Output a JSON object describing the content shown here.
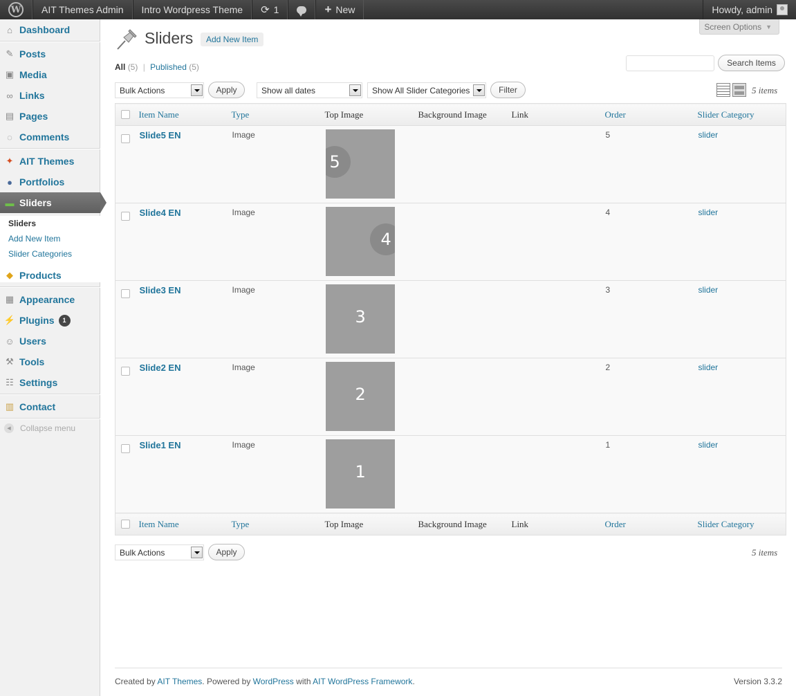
{
  "adminbar": {
    "site_admin": "AIT Themes Admin",
    "theme": "Intro Wordpress Theme",
    "updates_count": "1",
    "new_label": "New",
    "howdy": "Howdy, admin"
  },
  "sidebar": {
    "dashboard": "Dashboard",
    "posts": "Posts",
    "media": "Media",
    "links": "Links",
    "pages": "Pages",
    "comments": "Comments",
    "ait_themes": "AIT Themes",
    "portfolios": "Portfolios",
    "sliders": "Sliders",
    "submenu": {
      "sliders": "Sliders",
      "add_new": "Add New Item",
      "categories": "Slider Categories"
    },
    "products": "Products",
    "appearance": "Appearance",
    "plugins": "Plugins",
    "plugins_badge": "1",
    "users": "Users",
    "tools": "Tools",
    "settings": "Settings",
    "contact": "Contact",
    "collapse": "Collapse menu"
  },
  "main": {
    "screen_options": "Screen Options",
    "title": "Sliders",
    "add_new": "Add New Item",
    "views": {
      "all": "All",
      "all_count": "(5)",
      "sep": "|",
      "published": "Published",
      "published_count": "(5)"
    },
    "search_button": "Search Items",
    "search_value": "",
    "bulk_actions": "Bulk Actions",
    "apply": "Apply",
    "dates_filter": "Show all dates",
    "category_filter": "Show All Slider Categories",
    "filter_button": "Filter",
    "items_count": "5 items"
  },
  "table": {
    "columns": {
      "name": "Item Name",
      "type": "Type",
      "top_image": "Top Image",
      "background_image": "Background Image",
      "link": "Link",
      "order": "Order",
      "category": "Slider Category"
    },
    "rows": [
      {
        "name": "Slide5 EN",
        "type": "Image",
        "image_label": "5",
        "order": "5",
        "category": "slider"
      },
      {
        "name": "Slide4 EN",
        "type": "Image",
        "image_label": "4",
        "order": "4",
        "category": "slider"
      },
      {
        "name": "Slide3 EN",
        "type": "Image",
        "image_label": "3",
        "order": "3",
        "category": "slider"
      },
      {
        "name": "Slide2 EN",
        "type": "Image",
        "image_label": "2",
        "order": "2",
        "category": "slider"
      },
      {
        "name": "Slide1 EN",
        "type": "Image",
        "image_label": "1",
        "order": "1",
        "category": "slider"
      }
    ]
  },
  "footer": {
    "created_by": "Created by ",
    "ait_themes": "AIT Themes",
    "powered_by": ". Powered by ",
    "wordpress": "WordPress",
    "with": " with ",
    "framework": "AIT WordPress Framework",
    "end": ".",
    "version": "Version 3.3.2"
  }
}
